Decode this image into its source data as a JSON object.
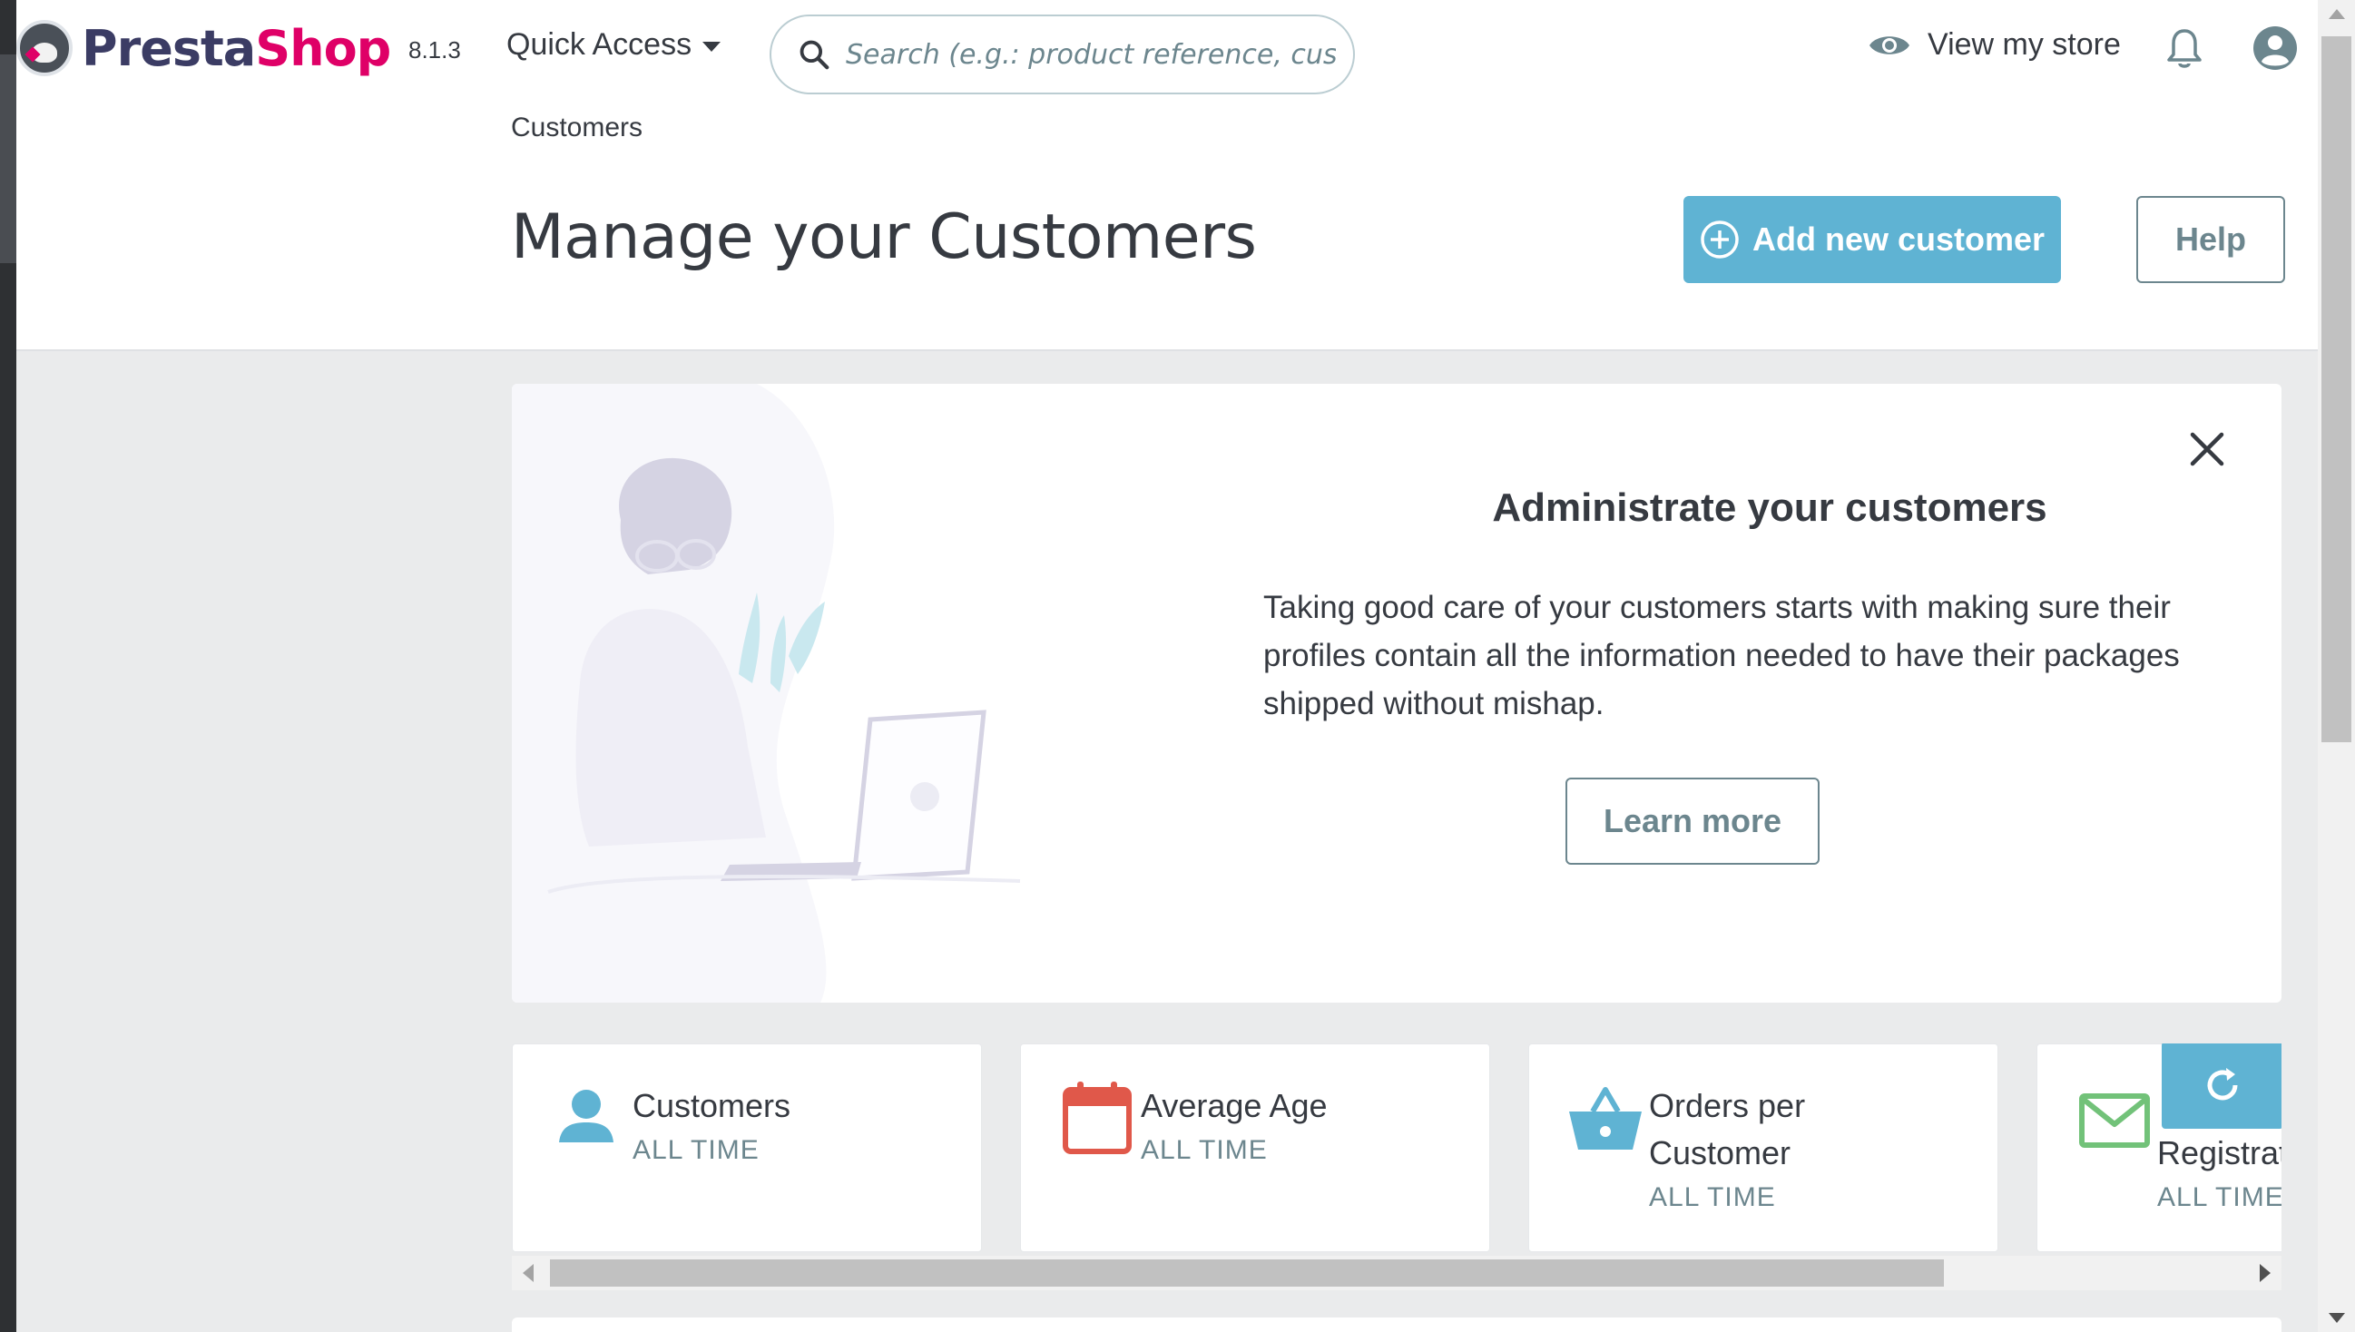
{
  "app": {
    "logo_text_1": "Presta",
    "logo_text_2": "Shop",
    "version": "8.1.3",
    "brand_colors": {
      "primary": "#3b3c64",
      "accent": "#df0067",
      "info": "#5fb3d3"
    }
  },
  "topbar": {
    "quick_access_label": "Quick Access",
    "search_placeholder": "Search (e.g.: product reference, custon",
    "view_store_label": "View my store",
    "icons": [
      "search-icon",
      "eye-icon",
      "bell-icon",
      "user-circle-icon",
      "chevron-down-icon"
    ]
  },
  "header": {
    "breadcrumb": "Customers",
    "page_title": "Manage your Customers",
    "add_button_label": "Add new customer",
    "help_button_label": "Help"
  },
  "banner": {
    "title": "Administrate your customers",
    "text": "Taking good care of your customers starts with making sure their profiles contain all the information needed to have their packages shipped without mishap.",
    "learn_more_label": "Learn more"
  },
  "kpis": [
    {
      "title": "Customers",
      "subtitle": "ALL TIME",
      "icon": "user-icon",
      "color": "#5fb3d3"
    },
    {
      "title": "Average Age",
      "subtitle": "ALL TIME",
      "icon": "calendar-icon",
      "color": "#e0584a"
    },
    {
      "title": "Orders per Customer",
      "subtitle": "ALL TIME",
      "icon": "basket-icon",
      "color": "#5fb3d3"
    },
    {
      "title": "Registrat",
      "subtitle": "ALL TIME",
      "icon": "envelope-icon",
      "color": "#72c279"
    }
  ]
}
